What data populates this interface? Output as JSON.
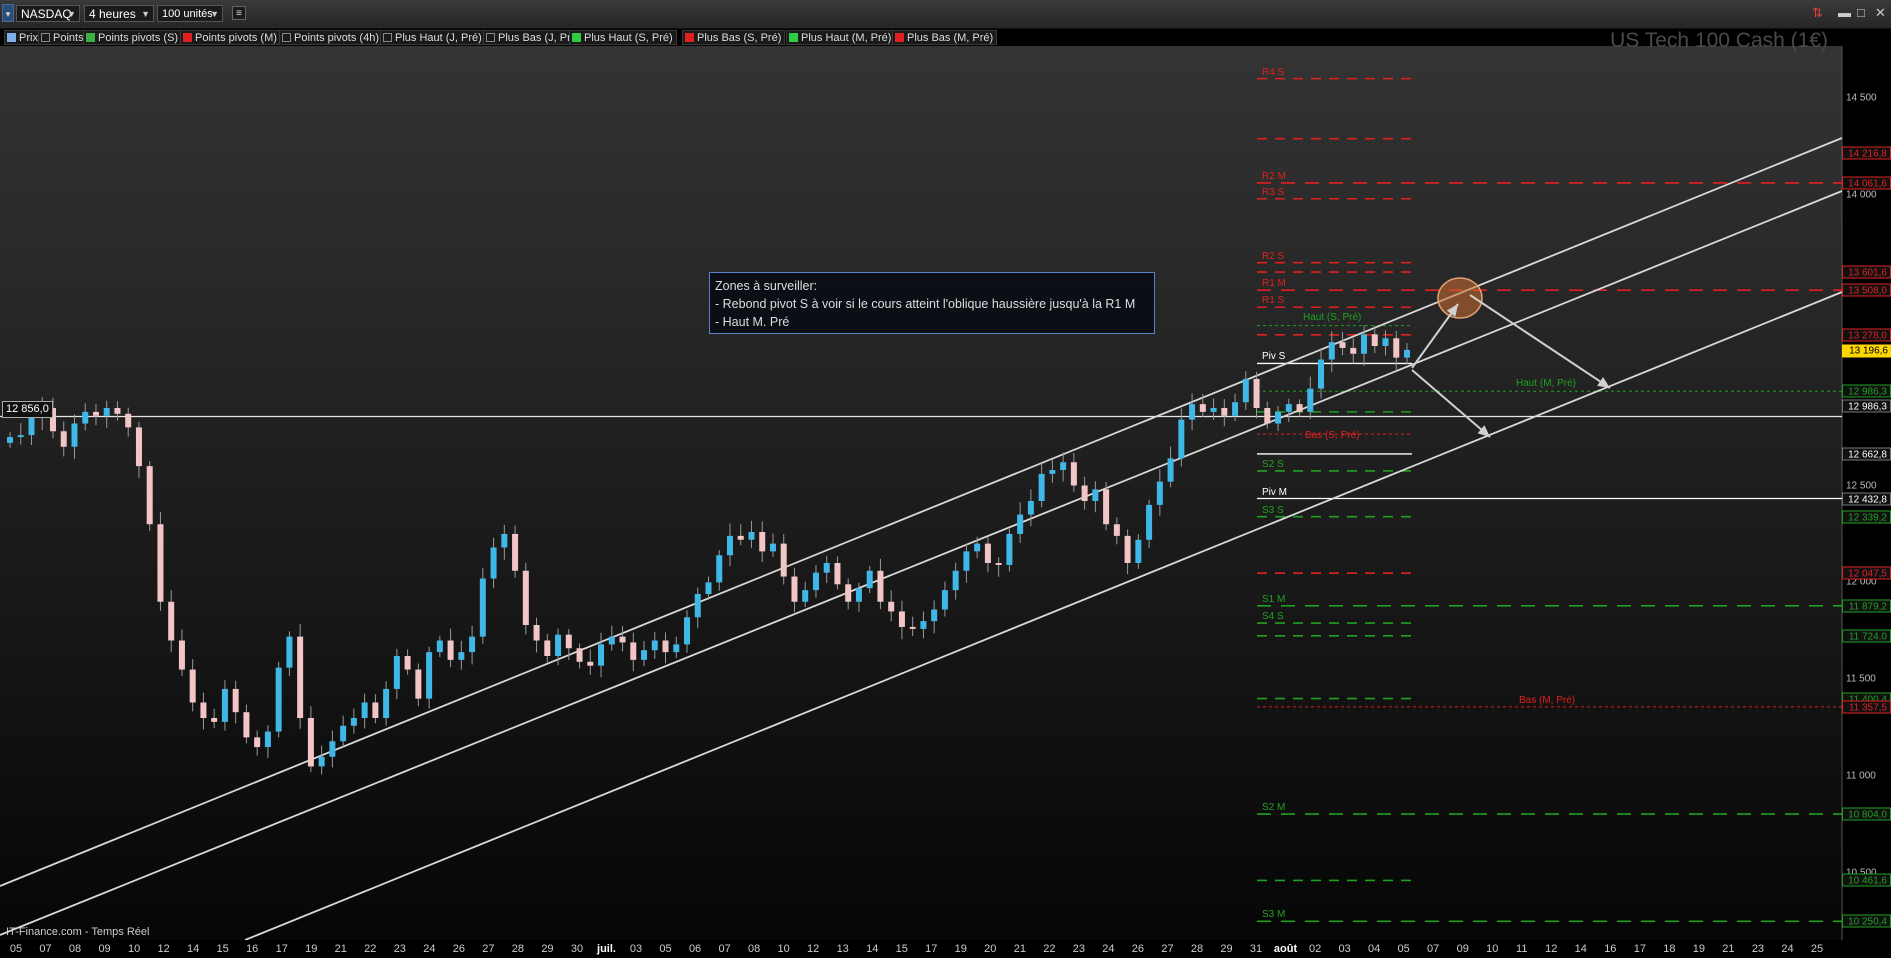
{
  "toolbar": {
    "symbol": "NASDAQ",
    "timeframe": "4 heures",
    "units": "100 unités",
    "settings_icon": "gear-icon"
  },
  "legend": [
    {
      "label": "Prix",
      "color": "#7fb0e8",
      "checked": true
    },
    {
      "label": "Points pivots (J)",
      "color": "#888888",
      "checked": false
    },
    {
      "label": "Points pivots (S)",
      "color": "#3cb043",
      "checked": true
    },
    {
      "label": "Points pivots (M)",
      "color": "#e02020",
      "checked": true
    },
    {
      "label": "Points pivots (4h)",
      "color": "#888888",
      "checked": false
    },
    {
      "label": "Plus Haut (J, Pré)",
      "color": "#888888",
      "checked": false
    },
    {
      "label": "Plus Bas (J, Pré)",
      "color": "#888888",
      "checked": false
    },
    {
      "label": "Plus Haut (S, Pré)",
      "color": "#2ecc40",
      "checked": true
    },
    {
      "label": "Plus Bas (S, Pré)",
      "color": "#e02020",
      "checked": true
    },
    {
      "label": "Plus Haut (M, Pré)",
      "color": "#2ecc40",
      "checked": true
    },
    {
      "label": "Plus Bas (M, Pré)",
      "color": "#e02020",
      "checked": true
    }
  ],
  "watermark": "US Tech 100 Cash (1€)",
  "note": {
    "lines": [
      "Zones à surveiller:",
      "- Rebond pivot S à voir si le cours atteint l'oblique haussière jusqu'à la R1 M",
      "- Haut M. Pré"
    ]
  },
  "reference_line_label": "12 856,0",
  "credit": "IT-Finance.com - Temps Réel",
  "colors": {
    "up_candle": "#3fb8e8",
    "down_candle": "#f2c6c6",
    "resistance": "#e02020",
    "support": "#20a020",
    "pivot": "#ffffff",
    "channel": "#d8d8d8",
    "note_border": "#5a80c8",
    "current_price_bg": "#ffd700"
  },
  "chart_data": {
    "type": "candlestick",
    "instrument": "US Tech 100 Cash (1€)",
    "timeframe": "4 heures",
    "y_axis_ticks": [
      "14 500",
      "14 000",
      "12 500",
      "12 000",
      "11 500",
      "11 000",
      "10 500"
    ],
    "y_axis_boxes": [
      {
        "value": "14 216,8",
        "color": "#e02020"
      },
      {
        "value": "14 061,6",
        "color": "#e02020"
      },
      {
        "value": "13 601,6",
        "color": "#e02020"
      },
      {
        "value": "13 508,0",
        "color": "#e02020"
      },
      {
        "value": "13 278,0",
        "color": "#e02020"
      },
      {
        "value": "13 196,6",
        "color": "#ffd700"
      },
      {
        "value": "12 986,3",
        "color": "#20a020"
      },
      {
        "value": "12 986,3",
        "color": "#ffffff"
      },
      {
        "value": "12 662,8",
        "color": "#ffffff"
      },
      {
        "value": "12 432,8",
        "color": "#ffffff"
      },
      {
        "value": "12 339,2",
        "color": "#20a020"
      },
      {
        "value": "12 047,5",
        "color": "#e02020"
      },
      {
        "value": "11 879,2",
        "color": "#20a020"
      },
      {
        "value": "11 724,0",
        "color": "#20a020"
      },
      {
        "value": "11 400,4",
        "color": "#20a020"
      },
      {
        "value": "11 357,5",
        "color": "#e02020"
      },
      {
        "value": "10 804,0",
        "color": "#20a020"
      },
      {
        "value": "10 461,6",
        "color": "#20a020"
      },
      {
        "value": "10 250,4",
        "color": "#20a020"
      }
    ],
    "x_axis_labels": [
      "05",
      "07",
      "08",
      "09",
      "10",
      "12",
      "14",
      "15",
      "16",
      "17",
      "19",
      "21",
      "22",
      "23",
      "24",
      "26",
      "27",
      "28",
      "29",
      "30",
      "juil.",
      "03",
      "05",
      "06",
      "07",
      "08",
      "10",
      "12",
      "13",
      "14",
      "15",
      "17",
      "19",
      "20",
      "21",
      "22",
      "23",
      "24",
      "26",
      "27",
      "28",
      "29",
      "31",
      "août",
      "02",
      "03",
      "04",
      "05",
      "07",
      "09",
      "10",
      "11",
      "12",
      "14",
      "16",
      "17",
      "18",
      "19",
      "21",
      "23",
      "24",
      "25"
    ],
    "levels": [
      {
        "label": "R4 S",
        "value": 14600,
        "color": "#e02020",
        "style": "dash"
      },
      {
        "label": "",
        "value": 14290,
        "color": "#e02020",
        "style": "dash"
      },
      {
        "label": "R2 M",
        "value": 14061.6,
        "color": "#e02020",
        "style": "dash-long"
      },
      {
        "label": "R3 S",
        "value": 13980,
        "color": "#e02020",
        "style": "dash"
      },
      {
        "label": "R2 S",
        "value": 13650,
        "color": "#e02020",
        "style": "dash"
      },
      {
        "label": "",
        "value": 13601.6,
        "color": "#e02020",
        "style": "dash"
      },
      {
        "label": "R1 M",
        "value": 13508,
        "color": "#e02020",
        "style": "dash-long"
      },
      {
        "label": "R1 S",
        "value": 13420,
        "color": "#e02020",
        "style": "dash"
      },
      {
        "label": "Haut (S, Pré)",
        "value": 13325,
        "color": "#20a020",
        "style": "dot"
      },
      {
        "label": "",
        "value": 13278,
        "color": "#e02020",
        "style": "dash"
      },
      {
        "label": "Piv S",
        "value": 13130,
        "color": "#ffffff",
        "style": "solid"
      },
      {
        "label": "Haut (M, Pré)",
        "value": 12986.3,
        "color": "#20a020",
        "style": "dot-long"
      },
      {
        "label": "",
        "value": 12880,
        "color": "#20a020",
        "style": "dash"
      },
      {
        "label": "Bas (S, Pré)",
        "value": 12765,
        "color": "#e02020",
        "style": "dot"
      },
      {
        "label": "",
        "value": 12662.8,
        "color": "#ffffff",
        "style": "solid"
      },
      {
        "label": "S2 S",
        "value": 12575,
        "color": "#20a020",
        "style": "dash"
      },
      {
        "label": "Piv M",
        "value": 12432.8,
        "color": "#ffffff",
        "style": "solid-long"
      },
      {
        "label": "S3 S",
        "value": 12339.2,
        "color": "#20a020",
        "style": "dash"
      },
      {
        "label": "",
        "value": 12047.5,
        "color": "#e02020",
        "style": "dash"
      },
      {
        "label": "S1 M",
        "value": 11879.2,
        "color": "#20a020",
        "style": "dash-long"
      },
      {
        "label": "S4 S",
        "value": 11790,
        "color": "#20a020",
        "style": "dash"
      },
      {
        "label": "",
        "value": 11724,
        "color": "#20a020",
        "style": "dash"
      },
      {
        "label": "",
        "value": 11400.4,
        "color": "#20a020",
        "style": "dash"
      },
      {
        "label": "Bas (M, Pré)",
        "value": 11357.5,
        "color": "#e02020",
        "style": "dot-long"
      },
      {
        "label": "S2 M",
        "value": 10804,
        "color": "#20a020",
        "style": "dash-long"
      },
      {
        "label": "",
        "value": 10461.6,
        "color": "#20a020",
        "style": "dash"
      },
      {
        "label": "S3 M",
        "value": 10250.4,
        "color": "#20a020",
        "style": "dash-long"
      }
    ],
    "current_price": 13196.6,
    "reference_price": 12856.0,
    "closes": [
      12750,
      12760,
      12850,
      12900,
      12780,
      12700,
      12820,
      12880,
      12860,
      12900,
      12870,
      12800,
      12600,
      12300,
      11900,
      11700,
      11550,
      11380,
      11300,
      11280,
      11450,
      11330,
      11200,
      11150,
      11230,
      11560,
      11720,
      11300,
      11050,
      11100,
      11180,
      11260,
      11300,
      11380,
      11300,
      11450,
      11620,
      11550,
      11400,
      11640,
      11700,
      11600,
      11640,
      11720,
      12020,
      12180,
      12250,
      12060,
      11780,
      11700,
      11620,
      11730,
      11660,
      11590,
      11570,
      11680,
      11720,
      11690,
      11600,
      11650,
      11700,
      11640,
      11680,
      11820,
      11940,
      12000,
      12140,
      12240,
      12220,
      12260,
      12160,
      12200,
      12030,
      11900,
      11960,
      12050,
      12100,
      11990,
      11900,
      11970,
      12060,
      11900,
      11850,
      11770,
      11760,
      11800,
      11860,
      11960,
      12060,
      12160,
      12200,
      12100,
      12090,
      12250,
      12350,
      12420,
      12560,
      12580,
      12620,
      12500,
      12420,
      12480,
      12300,
      12240,
      12100,
      12220,
      12400,
      12520,
      12640,
      12840,
      12920,
      12880,
      12900,
      12860,
      12930,
      13050,
      12900,
      12820,
      12880,
      12920,
      12880,
      13000,
      13150,
      13240,
      13210,
      13180,
      13280,
      13220,
      13260,
      13160,
      13200
    ]
  }
}
